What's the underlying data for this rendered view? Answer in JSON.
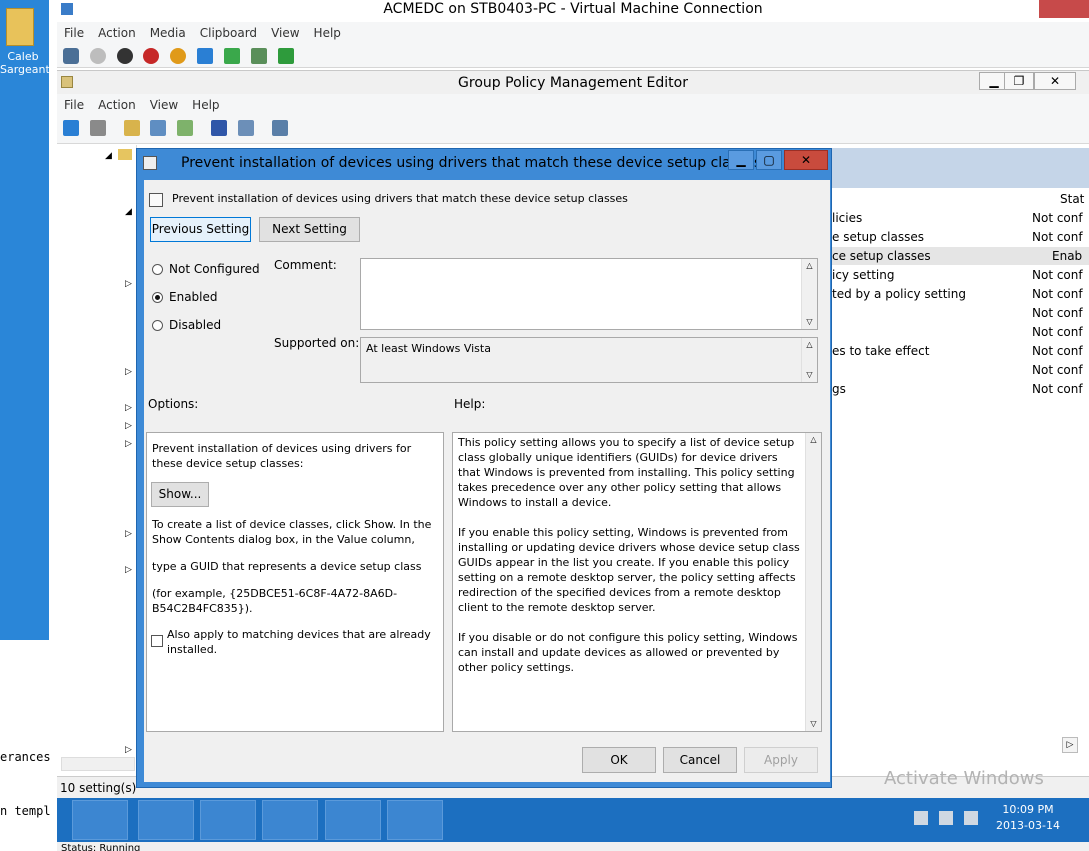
{
  "host": {
    "desktop_icon_label_line1": "Caleb",
    "desktop_icon_label_line2": "Sargeant",
    "bg_lines": [
      "erances",
      "n templ"
    ]
  },
  "vm_window": {
    "title": "ACMEDC on STB0403-PC - Virtual Machine Connection",
    "menu": [
      "File",
      "Action",
      "Media",
      "Clipboard",
      "View",
      "Help"
    ],
    "status": "Status: Running"
  },
  "gpme": {
    "title": "Group Policy Management Editor",
    "menu": [
      "File",
      "Action",
      "View",
      "Help"
    ],
    "status": "10 setting(s)",
    "right_pane": {
      "column_state": "Stat",
      "rows": [
        {
          "name": "licies",
          "state": "Not conf"
        },
        {
          "name": "e setup classes",
          "state": "Not conf"
        },
        {
          "name": "ce setup classes",
          "state": "Enab"
        },
        {
          "name": "icy setting",
          "state": "Not conf"
        },
        {
          "name": "ted by a policy setting",
          "state": "Not conf"
        },
        {
          "name": "",
          "state": "Not conf"
        },
        {
          "name": "",
          "state": "Not conf"
        },
        {
          "name": "es to take effect",
          "state": "Not conf"
        },
        {
          "name": "",
          "state": "Not conf"
        },
        {
          "name": "gs",
          "state": "Not conf"
        }
      ]
    }
  },
  "dialog": {
    "title": "Prevent installation of devices using drivers that match these device setup classes",
    "header_text": "Prevent installation of devices using drivers that match these device setup classes",
    "prev_button": "Previous Setting",
    "next_button": "Next Setting",
    "radio_not_configured": "Not Configured",
    "radio_enabled": "Enabled",
    "radio_disabled": "Disabled",
    "selected": "Enabled",
    "comment_label": "Comment:",
    "comment_value": "",
    "supported_label": "Supported on:",
    "supported_value": "At least Windows Vista",
    "options_label": "Options:",
    "help_label": "Help:",
    "options": {
      "intro": "Prevent installation of devices using drivers for these device setup classes:",
      "show_button": "Show...",
      "para1": "To create a list of device classes, click Show. In the Show Contents dialog box, in the Value column,",
      "para2": "type a GUID that represents a device setup class",
      "para3": "(for example, {25DBCE51-6C8F-4A72-8A6D-B54C2B4FC835}).",
      "checkbox_label": "Also apply to matching devices that are already installed."
    },
    "help": {
      "p1": "This policy setting allows you to specify a list of device setup class globally unique identifiers (GUIDs) for device drivers that Windows is prevented from installing. This policy setting takes precedence over any other policy setting that allows Windows to install a device.",
      "p2": "If you enable this policy setting, Windows is prevented from installing or updating device drivers whose device setup class GUIDs appear in the list you create. If you enable this policy setting on a remote desktop server, the policy setting affects redirection of the specified devices from a remote desktop client to the remote desktop server.",
      "p3": "If you disable or do not configure this policy setting, Windows can install and update devices as allowed or prevented by other policy settings."
    },
    "ok_button": "OK",
    "cancel_button": "Cancel",
    "apply_button": "Apply"
  },
  "watermark": {
    "text": "Activate Windows"
  },
  "taskbar": {
    "time": "10:09 PM",
    "date": "2013-03-14"
  },
  "colors": {
    "dialog_frame": "#3e8ad6",
    "taskbar": "#1c6fc0",
    "close_button": "#c74a4a"
  }
}
